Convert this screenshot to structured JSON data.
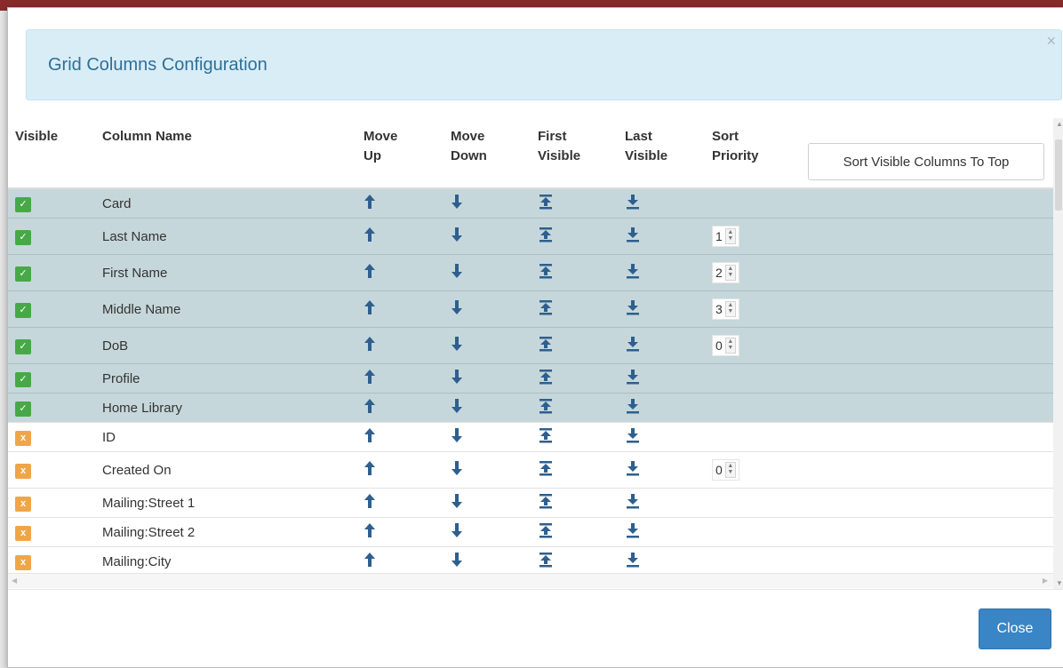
{
  "modal": {
    "title": "Grid Columns Configuration",
    "close_symbol": "×",
    "close_button_label": "Close"
  },
  "headers": {
    "visible": "Visible",
    "column_name": "Column Name",
    "move_up": [
      "Move",
      "Up"
    ],
    "move_down": [
      "Move",
      "Down"
    ],
    "first_visible": [
      "First",
      "Visible"
    ],
    "last_visible": [
      "Last",
      "Visible"
    ],
    "sort_priority": [
      "Sort",
      "Priority"
    ],
    "sort_button_label": "Sort Visible Columns To Top"
  },
  "rows": [
    {
      "name": "Card",
      "visible": true,
      "sort_priority": null,
      "check_symbol": "✓"
    },
    {
      "name": "Last Name",
      "visible": true,
      "sort_priority": "1",
      "check_symbol": "✓"
    },
    {
      "name": "First Name",
      "visible": true,
      "sort_priority": "2",
      "check_symbol": "✓"
    },
    {
      "name": "Middle Name",
      "visible": true,
      "sort_priority": "3",
      "check_symbol": "✓"
    },
    {
      "name": "DoB",
      "visible": true,
      "sort_priority": "0",
      "check_symbol": "✓"
    },
    {
      "name": "Profile",
      "visible": true,
      "sort_priority": null,
      "check_symbol": "✓"
    },
    {
      "name": "Home Library",
      "visible": true,
      "sort_priority": null,
      "check_symbol": "✓"
    },
    {
      "name": "ID",
      "visible": false,
      "sort_priority": null,
      "check_symbol": "x"
    },
    {
      "name": "Created On",
      "visible": false,
      "sort_priority": "0",
      "check_symbol": "x"
    },
    {
      "name": "Mailing:Street 1",
      "visible": false,
      "sort_priority": null,
      "check_symbol": "x"
    },
    {
      "name": "Mailing:Street 2",
      "visible": false,
      "sort_priority": null,
      "check_symbol": "x"
    },
    {
      "name": "Mailing:City",
      "visible": false,
      "sort_priority": null,
      "check_symbol": "x"
    }
  ],
  "icons": {
    "visible_on": "checkbox-checked-icon",
    "visible_off": "checkbox-unchecked-icon",
    "move_up": "arrow-up-icon",
    "move_down": "arrow-down-icon",
    "first_visible": "move-to-top-icon",
    "last_visible": "move-to-bottom-icon",
    "spinner": "spinner-arrows-icon"
  },
  "colors": {
    "header_bg": "#d9edf7",
    "title_color": "#2f6f96",
    "visible_row_bg": "#c6d7db",
    "check_on": "#46a946",
    "check_off": "#f0a646",
    "icon_color": "#2e5f8e",
    "primary_button": "#3a85c5"
  }
}
